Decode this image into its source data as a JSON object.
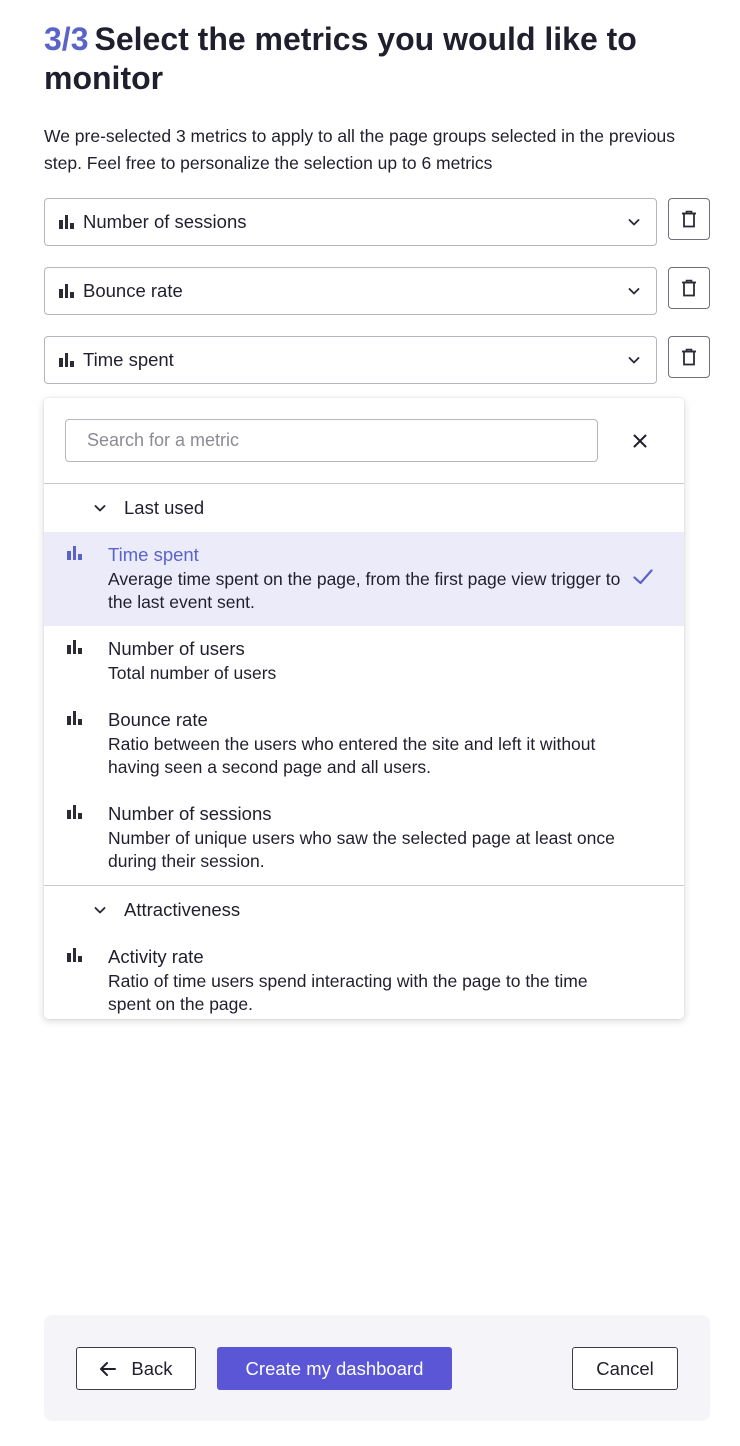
{
  "header": {
    "step": "3/3",
    "title": "Select the metrics you would like to monitor"
  },
  "intro": "We pre-selected 3 metrics to apply to all the page groups selected in the previous step. Feel free to personalize the selection up to 6 metrics",
  "selected_metrics": [
    {
      "label": "Number of sessions",
      "icon": "bar-chart-icon"
    },
    {
      "label": "Bounce rate",
      "icon": "bar-chart-icon"
    },
    {
      "label": "Time spent",
      "icon": "bar-chart-icon"
    }
  ],
  "dropdown": {
    "search_placeholder": "Search for a metric",
    "groups": [
      {
        "label": "Last used",
        "options": [
          {
            "title": "Time spent",
            "description": "Average time spent on the page, from the first page view trigger to the last event sent.",
            "selected": true
          },
          {
            "title": "Number of users",
            "description": "Total number of users",
            "selected": false
          },
          {
            "title": "Bounce rate",
            "description": "Ratio between the users who entered the site and left it without having seen a second page and all users.",
            "selected": false
          },
          {
            "title": "Number of sessions",
            "description": "Number of unique users who saw the selected page at least once during their session.",
            "selected": false
          }
        ]
      },
      {
        "label": "Attractiveness",
        "options": [
          {
            "title": "Activity rate",
            "description": "Ratio of time users spend interacting with the page to the time spent on the page.",
            "selected": false
          }
        ]
      }
    ]
  },
  "footer": {
    "back_label": "Back",
    "create_label": "Create my dashboard",
    "cancel_label": "Cancel"
  },
  "colors": {
    "accent": "#5a64c8",
    "primary_button": "#5a56d6",
    "selected_row_bg": "#ebebfa"
  }
}
